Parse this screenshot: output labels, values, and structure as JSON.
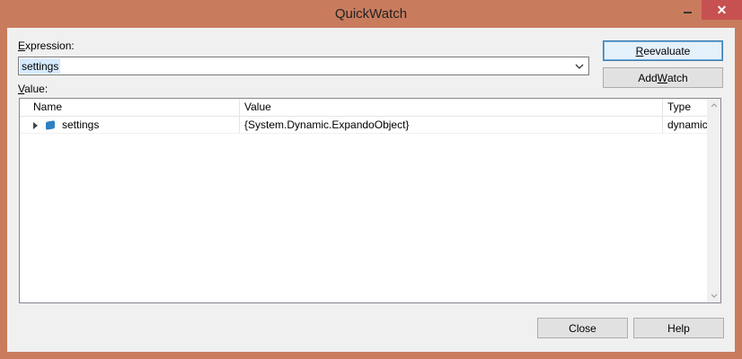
{
  "window": {
    "title": "QuickWatch",
    "minimize_icon": "minimize-icon",
    "close_icon": "close-icon",
    "close_glyph": "✕"
  },
  "expression": {
    "label_prefix": "",
    "label_hotkey": "E",
    "label_rest": "xpression:",
    "value": "settings",
    "dropdown_glyph": "⌄"
  },
  "value_section": {
    "label_hotkey": "V",
    "label_rest": "alue:"
  },
  "buttons": {
    "reevaluate_hotkey": "R",
    "reevaluate_rest": "eevaluate",
    "addwatch_prefix": "Add ",
    "addwatch_hotkey": "W",
    "addwatch_rest": "atch",
    "close": "Close",
    "help": "Help"
  },
  "grid": {
    "columns": [
      "Name",
      "Value",
      "Type"
    ],
    "rows": [
      {
        "name": "settings",
        "value": "{System.Dynamic.ExpandoObject}",
        "type": "dynamic",
        "icon": "object-icon"
      }
    ]
  },
  "colors": {
    "frame": "#c97c5d",
    "close_button": "#c75050",
    "client": "#f0f0f0",
    "selection": "#3399ff"
  }
}
